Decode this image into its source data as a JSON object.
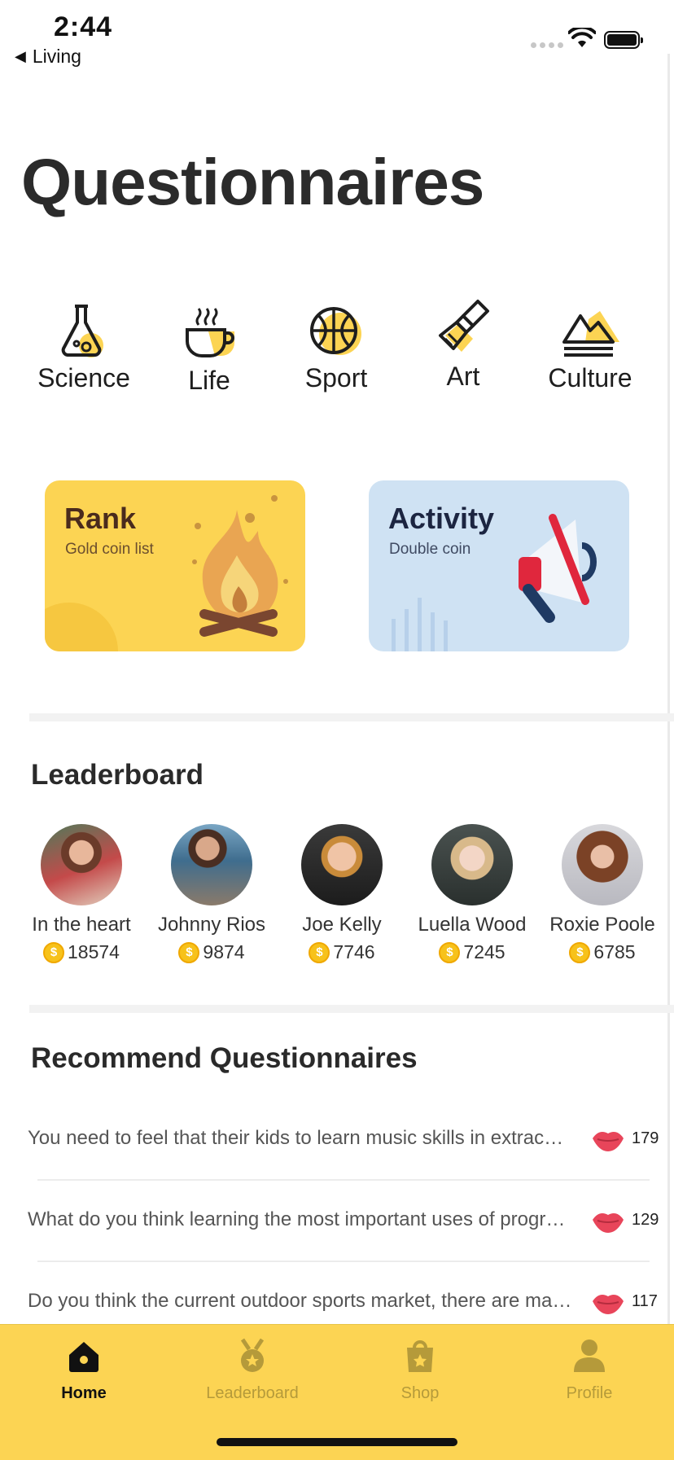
{
  "status_bar": {
    "time": "2:44",
    "back_label": "Living"
  },
  "page_title": "Questionnaires",
  "categories": [
    {
      "label": "Science",
      "icon": "flask-icon"
    },
    {
      "label": "Life",
      "icon": "coffee-cup-icon"
    },
    {
      "label": "Sport",
      "icon": "basketball-icon"
    },
    {
      "label": "Art",
      "icon": "paint-brush-icon"
    },
    {
      "label": "Culture",
      "icon": "mountain-icon"
    }
  ],
  "cards": {
    "rank": {
      "title": "Rank",
      "subtitle": "Gold coin list",
      "color": "#fcd453"
    },
    "activity": {
      "title": "Activity",
      "subtitle": "Double coin",
      "color": "#cfe2f3"
    }
  },
  "leaderboard": {
    "title": "Leaderboard",
    "users": [
      {
        "name": "In the heart",
        "coins": "18574"
      },
      {
        "name": "Johnny Rios",
        "coins": "9874"
      },
      {
        "name": "Joe Kelly",
        "coins": "7746"
      },
      {
        "name": "Luella Wood",
        "coins": "7245"
      },
      {
        "name": "Roxie Poole",
        "coins": "6785"
      }
    ]
  },
  "recommend": {
    "title": "Recommend Questionnaires",
    "items": [
      {
        "question": "You need to feel that their kids to learn music skills in extracurricular",
        "likes": "179"
      },
      {
        "question": "What do you think learning the most important uses of programming",
        "likes": "129"
      },
      {
        "question": "Do you think the current outdoor sports market, there are many choices",
        "likes": "117"
      }
    ]
  },
  "tabs": [
    {
      "label": "Home",
      "icon": "home-icon",
      "active": true
    },
    {
      "label": "Leaderboard",
      "icon": "medal-icon",
      "active": false
    },
    {
      "label": "Shop",
      "icon": "shopping-bag-icon",
      "active": false
    },
    {
      "label": "Profile",
      "icon": "person-icon",
      "active": false
    }
  ],
  "colors": {
    "accent": "#fcd453",
    "activity_card": "#cfe2f3",
    "lips": "#e8455a"
  }
}
